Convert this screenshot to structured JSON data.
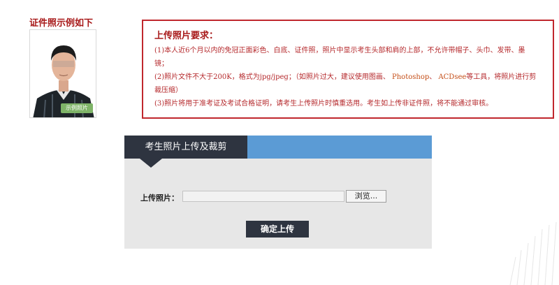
{
  "example": {
    "title": "证件照示例如下",
    "tag": "示例照片"
  },
  "requirements": {
    "title": "上传照片要求：",
    "line1": "(1)本人近6个月以内的免冠正面彩色、白底、证件照，照片中显示考生头部和肩的上部，不允许带帽子、头巾、发带、墨",
    "line1b": "镜；",
    "line2a": "(2)照片文件不大于200K，格式为jpg/jpeg；（如照片过大，建议使用图画、",
    "line2_photoshop": "Photoshop",
    "line2_sep": "、",
    "line2_acdsee": "ACDsee",
    "line2b": "等工具，将照片进行剪",
    "line2c": "裁压缩）",
    "line3": "(3)照片将用于准考证及考试合格证明，请考生上传照片时慎重选用。考生如上传非证件照，将不能通过审核。"
  },
  "upload": {
    "tab_label": "考生照片上传及裁剪",
    "field_label": "上传照片：",
    "file_value": "",
    "browse_label": "浏览...",
    "submit_label": "确定上传"
  },
  "colors": {
    "accent_red": "#c0272d",
    "header_blue": "#5b9bd5",
    "tab_dark": "#2e3440",
    "panel_bg": "#e7e7e7"
  }
}
